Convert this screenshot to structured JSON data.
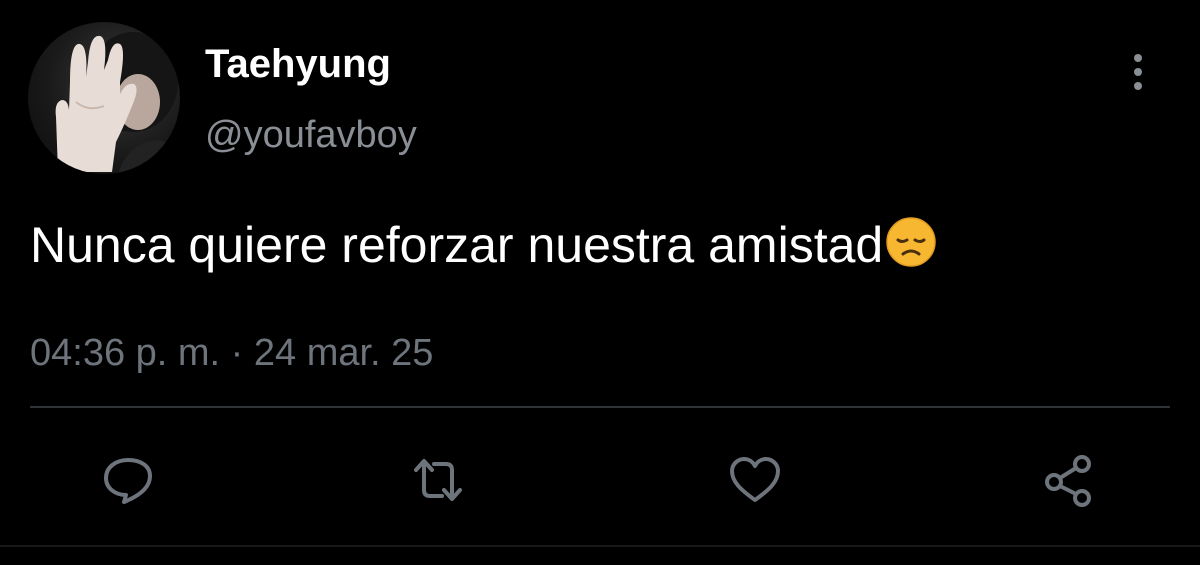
{
  "tweet": {
    "display_name": "Taehyung",
    "handle": "@youfavboy",
    "text": "Nunca quiere reforzar nuestra amistad",
    "emoji": "disappointed-face-emoji",
    "timestamp": "04:36 p. m. · 24 mar. 25"
  },
  "icons": {
    "more": "more-vertical-icon",
    "reply": "reply-icon",
    "retweet": "retweet-icon",
    "like": "heart-icon",
    "share": "share-icon"
  },
  "colors": {
    "background": "#000000",
    "text_primary": "#ffffff",
    "text_secondary": "#6e747b",
    "icon": "#6e747b",
    "divider": "#2f3336",
    "emoji": "#f7b731"
  }
}
